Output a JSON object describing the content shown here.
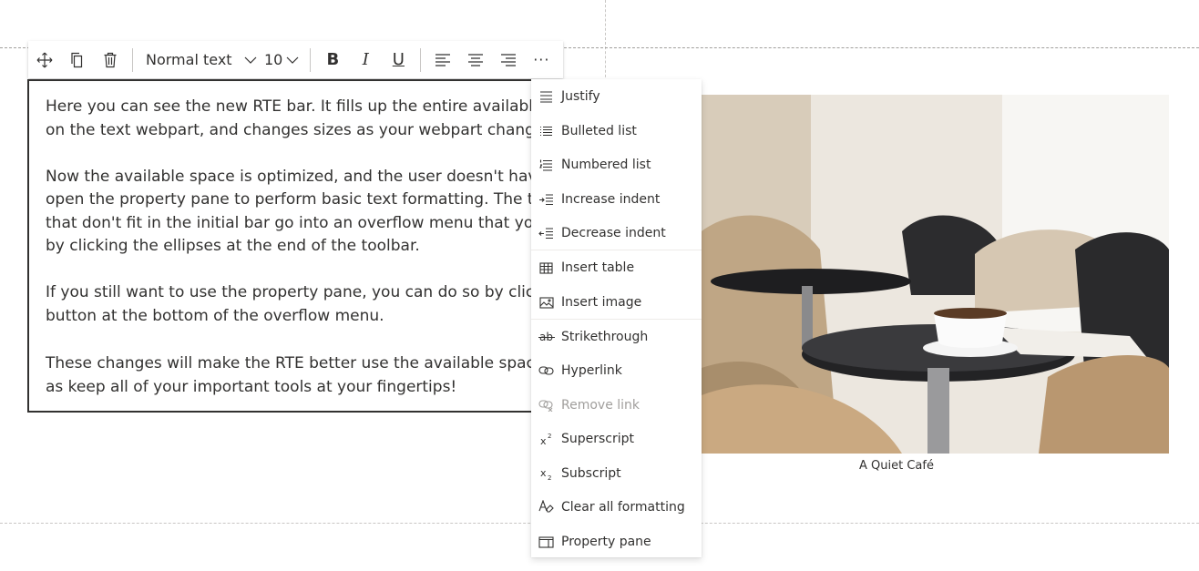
{
  "toolbar": {
    "icons": [
      "move-icon",
      "duplicate-icon",
      "delete-icon"
    ],
    "text_style": "Normal text",
    "font_size": "10",
    "bold_label": "B",
    "italic_label": "I",
    "underline_label": "U",
    "align_icons": [
      "align-left-icon",
      "align-center-icon",
      "align-right-icon"
    ],
    "more_label": "···"
  },
  "text_webpart": {
    "paragraphs": [
      [
        "Here you can see the new RTE bar. It fills up the entire available w",
        "on the text webpart, and changes sizes as your webpart changes"
      ],
      [
        "Now the available space is optimized, and the user doesn't have t",
        "open the property pane to perform basic text formatting.  The to",
        "that don't fit in the initial bar go into an overflow menu that you",
        "by clicking the ellipses at the end of the toolbar."
      ],
      [
        "If you still want to use the property pane, you can do so by clickir",
        "button at the bottom of the overflow menu."
      ],
      [
        "These changes will make the RTE better use the available space, a",
        "as keep all of your important tools at your fingertips!"
      ]
    ]
  },
  "image": {
    "caption": "A Quiet Café"
  },
  "overflow_menu": {
    "items": [
      {
        "label": "Justify",
        "icon": "justify-icon",
        "enabled": true
      },
      {
        "label": "Bulleted list",
        "icon": "bulleted-list-icon",
        "enabled": true
      },
      {
        "label": "Numbered list",
        "icon": "numbered-list-icon",
        "enabled": true
      },
      {
        "label": "Increase indent",
        "icon": "increase-indent-icon",
        "enabled": true
      },
      {
        "label": "Decrease indent",
        "icon": "decrease-indent-icon",
        "enabled": true
      },
      {
        "label": "Insert table",
        "icon": "table-icon",
        "enabled": true
      },
      {
        "label": "Insert image",
        "icon": "image-icon",
        "enabled": true
      },
      {
        "label": "Strikethrough",
        "icon": "strikethrough-icon",
        "enabled": true
      },
      {
        "label": "Hyperlink",
        "icon": "link-icon",
        "enabled": true
      },
      {
        "label": "Remove link",
        "icon": "remove-link-icon",
        "enabled": false
      },
      {
        "label": "Superscript",
        "icon": "superscript-icon",
        "enabled": true
      },
      {
        "label": "Subscript",
        "icon": "subscript-icon",
        "enabled": true
      },
      {
        "label": "Clear all formatting",
        "icon": "clear-formatting-icon",
        "enabled": true
      },
      {
        "label": "Property pane",
        "icon": "property-pane-icon",
        "enabled": true
      }
    ]
  },
  "colors": {
    "text": "#323130",
    "disabled_text": "#a19f9d",
    "divider": "#edebe9",
    "border": "#323130"
  }
}
